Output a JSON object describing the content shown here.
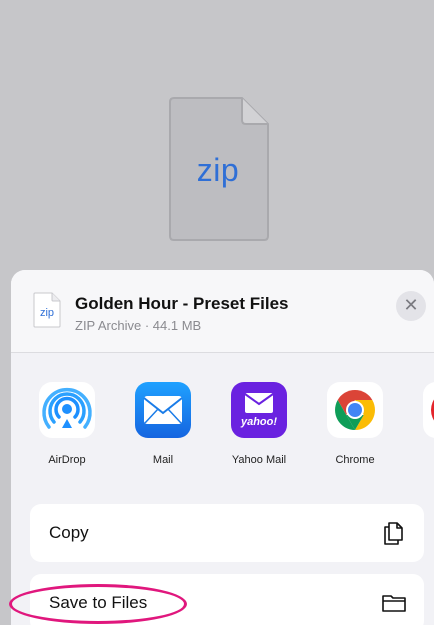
{
  "preview": {
    "file_type_label": "zip"
  },
  "sheet": {
    "file_thumb_label": "zip",
    "title": "Golden Hour - Preset Files",
    "subtitle": "ZIP Archive · 44.1 MB",
    "close_label": "✕"
  },
  "apps": [
    {
      "label": "AirDrop",
      "icon": "airdrop-icon"
    },
    {
      "label": "Mail",
      "icon": "mail-icon"
    },
    {
      "label": "Yahoo Mail",
      "icon": "yahoo-mail-icon",
      "icon_text": "yahoo!"
    },
    {
      "label": "Chrome",
      "icon": "chrome-icon"
    },
    {
      "label": "",
      "icon": "partial-app-icon"
    }
  ],
  "actions": [
    {
      "label": "Copy",
      "icon": "copy-icon"
    },
    {
      "label": "Save to Files",
      "icon": "folder-icon"
    }
  ],
  "colors": {
    "accent_blue": "#2f6fd6",
    "highlight": "#e0177d",
    "sheet_bg": "#f2f2f6"
  }
}
